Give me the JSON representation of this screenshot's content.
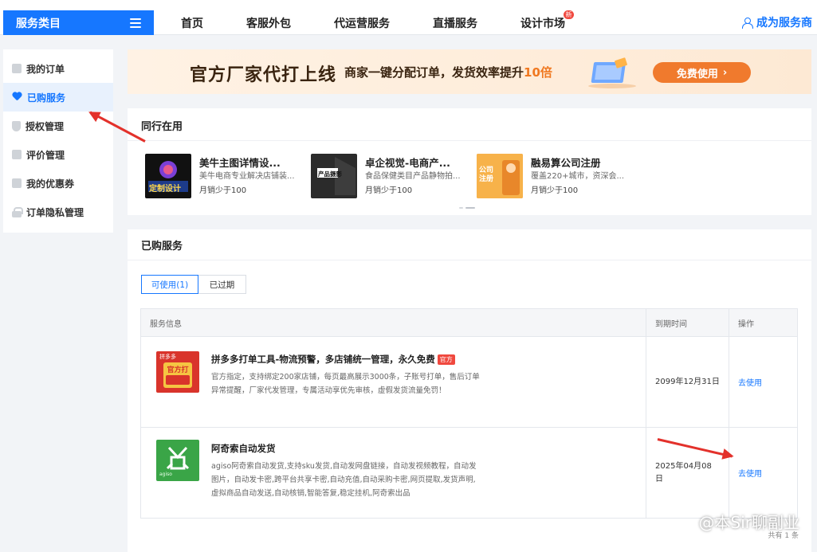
{
  "header": {
    "category_label": "服务类目",
    "nav": [
      {
        "label": "首页",
        "badge": ""
      },
      {
        "label": "客服外包",
        "badge": ""
      },
      {
        "label": "代运营服务",
        "badge": ""
      },
      {
        "label": "直播服务",
        "badge": ""
      },
      {
        "label": "设计市场",
        "badge": "新"
      }
    ],
    "merchant_link": "成为服务商"
  },
  "sidebar": {
    "items": [
      {
        "label": "我的订单",
        "icon": "order-icon",
        "active": false
      },
      {
        "label": "已购服务",
        "icon": "heart-icon",
        "active": true
      },
      {
        "label": "授权管理",
        "icon": "shield-icon",
        "active": false
      },
      {
        "label": "评价管理",
        "icon": "review-icon",
        "active": false
      },
      {
        "label": "我的优惠券",
        "icon": "coupon-icon",
        "active": false
      },
      {
        "label": "订单隐私管理",
        "icon": "lock-icon",
        "active": false
      }
    ]
  },
  "banner": {
    "title": "官方厂家代打上线",
    "subtitle_prefix": "商家一键分配订单，发货效率提升",
    "subtitle_highlight": "10倍",
    "button_label": "免费使用",
    "button_icon": "›"
  },
  "peers": {
    "title": "同行在用",
    "items": [
      {
        "name": "美牛主图详情设...",
        "desc": "美牛电商专业解决店铺装...",
        "sales": "月销少于100",
        "thumb_text": "定制设计"
      },
      {
        "name": "卓企视觉-电商产...",
        "desc": "食品保健类目产品静物拍...",
        "sales": "月销少于100",
        "thumb_text": "产品摄影"
      },
      {
        "name": "融易算公司注册",
        "desc": "覆盖220+城市，资深会...",
        "sales": "月销少于100",
        "thumb_text": "公司注册"
      }
    ]
  },
  "purchased": {
    "title": "已购服务",
    "tabs": [
      {
        "label": "可使用(1)",
        "active": true
      },
      {
        "label": "已过期",
        "active": false
      }
    ],
    "columns": [
      "服务信息",
      "到期时间",
      "操作"
    ],
    "rows": [
      {
        "name": "拼多多打单工具-物流预警，多店铺统一管理，永久免费",
        "tag": "官方",
        "logo_top": "拼多多",
        "logo_text": "官方打单",
        "desc": "官方指定，支持绑定200家店铺，每页最高展示3000条，子账号打单，售后订单异常提醒，厂家代发管理，专属活动享优先审核，虚假发货流量免罚！",
        "expire": "2099年12月31日",
        "action": "去使用"
      },
      {
        "name": "阿奇索自动发货",
        "tag": "",
        "logo_top": "",
        "logo_text": "agiso",
        "desc": "agiso阿奇索自动发货,支持sku发货,自动发网盘链接，自动发视频教程，自动发图片，自动发卡密,跨平台共享卡密,自动充值,自动采购卡密,网页提取,发货声明,虚拟商品自动发送,自动核销,智能答复,稳定挂机,阿奇索出品",
        "expire": "2025年04月08日",
        "action": "去使用"
      }
    ],
    "total": "共有 1 条"
  },
  "watermark": "@本Sir聊副业",
  "colors": {
    "accent": "#1677ff",
    "orange": "#f07a2d",
    "red": "#e3312b"
  }
}
